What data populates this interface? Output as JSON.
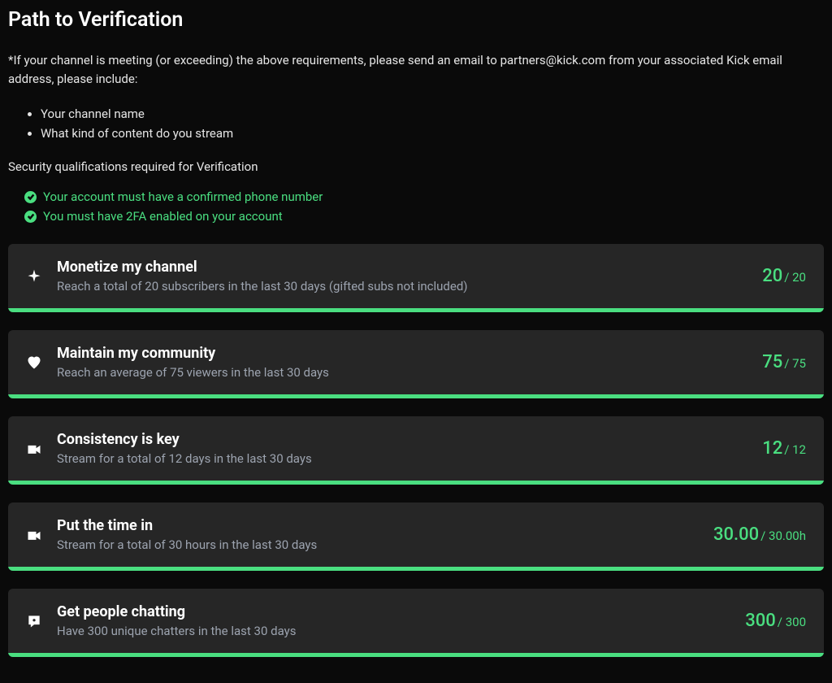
{
  "title": "Path to Verification",
  "intro": "*If your channel is meeting (or exceeding) the above requirements, please send an email to partners@kick.com from your associated Kick email address, please include:",
  "bullets": [
    "Your channel name",
    "What kind of content do you stream"
  ],
  "security_heading": "Security qualifications required for Verification",
  "security_items": [
    "Your account must have a confirmed phone number",
    "You must have 2FA enabled on your account"
  ],
  "cards": [
    {
      "icon": "sparkle-icon",
      "title": "Monetize my channel",
      "desc": "Reach a total of 20 subscribers in the last 30 days (gifted subs not included)",
      "current": "20",
      "total": "/ 20",
      "progress": 100
    },
    {
      "icon": "heart-icon",
      "title": "Maintain my community",
      "desc": "Reach an average of 75 viewers in the last 30 days",
      "current": "75",
      "total": "/ 75",
      "progress": 100
    },
    {
      "icon": "camera-icon",
      "title": "Consistency is key",
      "desc": "Stream for a total of 12 days in the last 30 days",
      "current": "12",
      "total": "/ 12",
      "progress": 100
    },
    {
      "icon": "camera-icon",
      "title": "Put the time in",
      "desc": "Stream for a total of 30 hours in the last 30 days",
      "current": "30.00",
      "total": "/ 30.00h",
      "progress": 100
    },
    {
      "icon": "chat-icon",
      "title": "Get people chatting",
      "desc": "Have 300 unique chatters in the last 30 days",
      "current": "300",
      "total": "/ 300",
      "progress": 100
    }
  ]
}
